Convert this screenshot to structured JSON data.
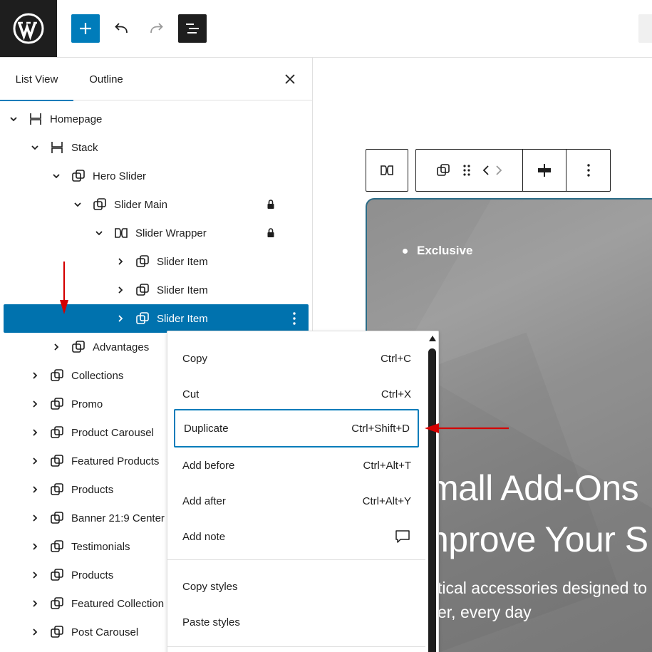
{
  "colors": {
    "accent": "#007cba",
    "selected": "#0072ae",
    "annotation": "#d40000",
    "dark": "#1e1e1e"
  },
  "toolbar": {
    "logo_icon": "wordpress-logo",
    "add_icon": "plus-icon",
    "undo_icon": "undo-icon",
    "redo_icon": "redo-icon",
    "list_view_icon": "list-view-icon"
  },
  "panel": {
    "tabs": [
      {
        "label": "List View"
      },
      {
        "label": "Outline"
      }
    ],
    "close_icon": "close-icon",
    "rows": [
      {
        "label": "Homepage"
      },
      {
        "label": "Stack"
      },
      {
        "label": "Hero Slider"
      },
      {
        "label": "Slider Main"
      },
      {
        "label": "Slider Wrapper"
      },
      {
        "label": "Slider Item"
      },
      {
        "label": "Slider Item"
      },
      {
        "label": "Slider Item"
      },
      {
        "label": "Advantages"
      },
      {
        "label": "Collections"
      },
      {
        "label": "Promo"
      },
      {
        "label": "Product Carousel"
      },
      {
        "label": "Featured Products"
      },
      {
        "label": "Products"
      },
      {
        "label": "Banner 21:9 Center"
      },
      {
        "label": "Testimonials"
      },
      {
        "label": "Products"
      },
      {
        "label": "Featured Collection"
      },
      {
        "label": "Post Carousel"
      }
    ]
  },
  "context_menu": {
    "items": [
      {
        "label": "Copy",
        "shortcut": "Ctrl+C"
      },
      {
        "label": "Cut",
        "shortcut": "Ctrl+X"
      },
      {
        "label": "Duplicate",
        "shortcut": "Ctrl+Shift+D"
      },
      {
        "label": "Add before",
        "shortcut": "Ctrl+Alt+T"
      },
      {
        "label": "Add after",
        "shortcut": "Ctrl+Alt+Y"
      },
      {
        "label": "Add note",
        "shortcut": ""
      },
      {
        "label": "Copy styles",
        "shortcut": ""
      },
      {
        "label": "Paste styles",
        "shortcut": ""
      }
    ]
  },
  "canvas": {
    "hero": {
      "bullet": "Exclusive",
      "heading_line1": "mall Add-Ons",
      "heading_line2": "nprove Your S",
      "sub_line1": "tical accessories designed to",
      "sub_line2": "er, every day"
    }
  }
}
